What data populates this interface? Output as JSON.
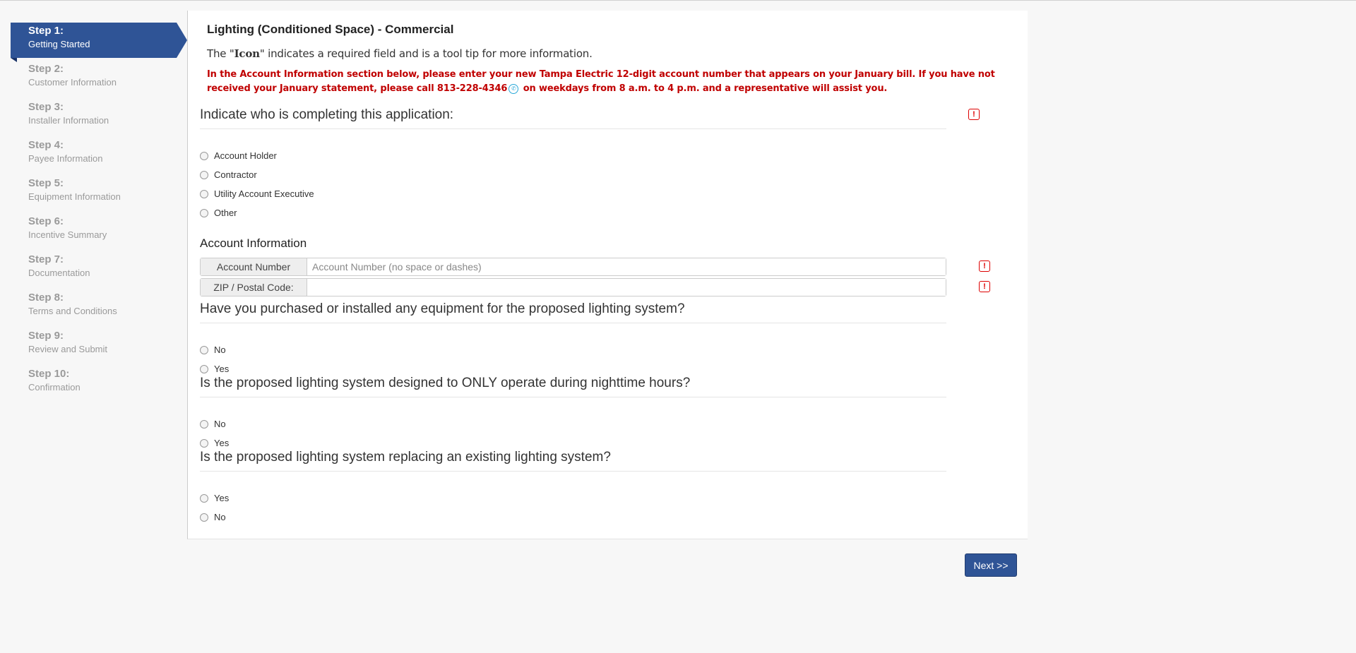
{
  "sidebar": {
    "steps": [
      {
        "title": "Step 1:",
        "desc": "Getting Started",
        "active": true
      },
      {
        "title": "Step 2:",
        "desc": "Customer Information"
      },
      {
        "title": "Step 3:",
        "desc": "Installer Information"
      },
      {
        "title": "Step 4:",
        "desc": "Payee Information"
      },
      {
        "title": "Step 5:",
        "desc": "Equipment Information"
      },
      {
        "title": "Step 6:",
        "desc": "Incentive Summary"
      },
      {
        "title": "Step 7:",
        "desc": "Documentation"
      },
      {
        "title": "Step 8:",
        "desc": "Terms and Conditions"
      },
      {
        "title": "Step 9:",
        "desc": "Review and Submit"
      },
      {
        "title": "Step 10:",
        "desc": "Confirmation"
      }
    ]
  },
  "main": {
    "title": "Lighting (Conditioned Space) - Commercial",
    "note_prefix": "The \"",
    "note_icon": "Icon",
    "note_suffix": "\" indicates a required field and is a tool tip for more information.",
    "alert_part1": "In the Account Information section below, please enter your new Tampa Electric 12-digit account number that appears on your January bill.  If you have not received your January statement, please call 813-228-4346",
    "alert_part2": " on weekdays from 8 a.m. to 4 p.m. and a representative will assist you.",
    "required_icon": "!",
    "q1": {
      "label": "Indicate who is completing this application:",
      "options": [
        "Account Holder",
        "Contractor",
        "Utility Account Executive",
        "Other"
      ]
    },
    "account_section": {
      "label": "Account Information",
      "account_number_label": "Account Number",
      "account_number_placeholder": "Account Number (no space or dashes)",
      "account_number_value": "",
      "zip_label": "ZIP / Postal Code:",
      "zip_value": ""
    },
    "q2": {
      "label": "Have you purchased or installed any equipment for the proposed lighting system?",
      "options": [
        "No",
        "Yes"
      ]
    },
    "q3": {
      "label": "Is the proposed lighting system designed to ONLY operate during nighttime hours?",
      "options": [
        "No",
        "Yes"
      ]
    },
    "q4": {
      "label": "Is the proposed lighting system replacing an existing lighting system?",
      "options": [
        "Yes",
        "No"
      ]
    },
    "next_label": "Next >>"
  },
  "colors": {
    "accent": "#2f5496",
    "alert": "#c00000",
    "required": "#dd0000"
  },
  "icons": {
    "phone": "phone-icon",
    "required": "required-field-icon"
  }
}
